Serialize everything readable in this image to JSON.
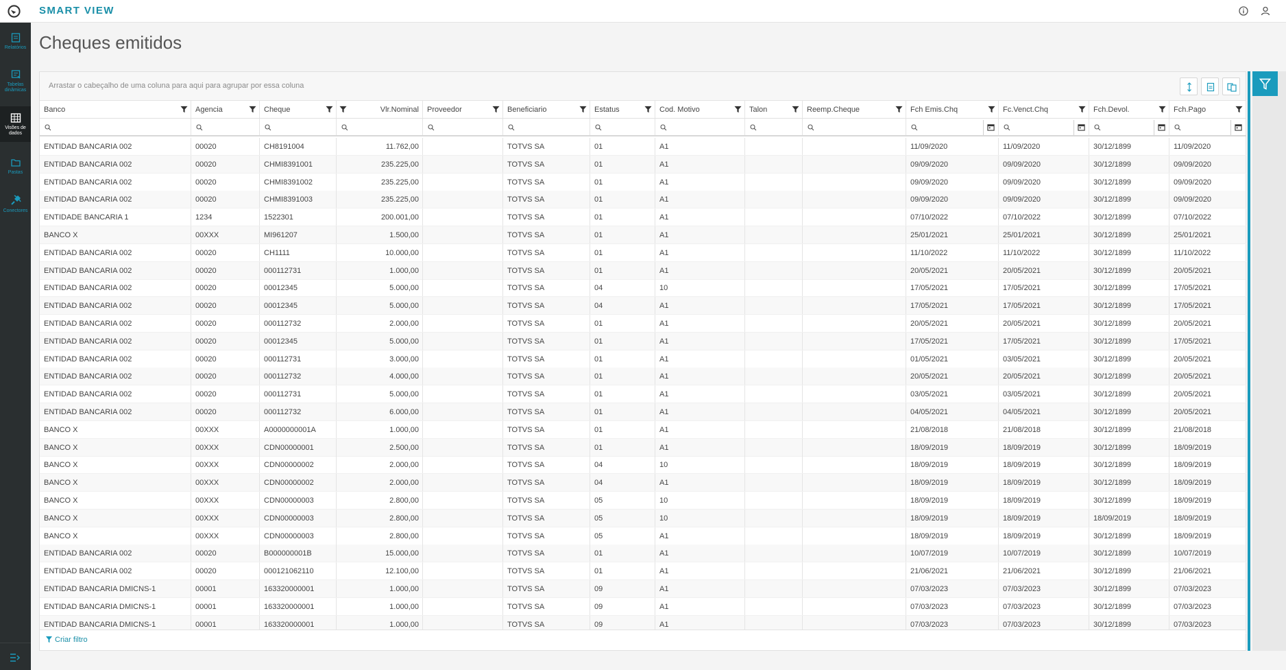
{
  "app": {
    "brand": "SMART VIEW"
  },
  "sidebar": {
    "items": [
      {
        "label": "Relatórios",
        "icon": "report-icon"
      },
      {
        "label": "Tabelas dinâmicas",
        "icon": "pivot-table-icon"
      },
      {
        "label": "Visões de dados",
        "icon": "data-grid-icon"
      },
      {
        "label": "Pastas",
        "icon": "folder-icon"
      },
      {
        "label": "Conectores",
        "icon": "plug-icon"
      }
    ]
  },
  "page": {
    "title": "Cheques emitidos"
  },
  "grid": {
    "group_hint": "Arrastar o cabeçalho de uma coluna para aqui para agrupar por essa coluna",
    "create_filter": "Criar filtro",
    "columns": [
      "Banco",
      "Agencia",
      "Cheque",
      "Vlr.Nominal",
      "Proveedor",
      "Beneficiario",
      "Estatus",
      "Cod. Motivo",
      "Talon",
      "Reemp.Cheque",
      "Fch Emis.Chq",
      "Fc.Venct.Chq",
      "Fch.Devol.",
      "Fch.Pago"
    ],
    "rows": [
      [
        "ENTIDAD BANCARIA 002",
        "00020",
        "CH8191004",
        "11.762,00",
        "",
        "TOTVS SA",
        "01",
        "A1",
        "",
        "",
        "11/09/2020",
        "11/09/2020",
        "30/12/1899",
        "11/09/2020"
      ],
      [
        "ENTIDAD BANCARIA 002",
        "00020",
        "CHMI8391001",
        "235.225,00",
        "",
        "TOTVS SA",
        "01",
        "A1",
        "",
        "",
        "09/09/2020",
        "09/09/2020",
        "30/12/1899",
        "09/09/2020"
      ],
      [
        "ENTIDAD BANCARIA 002",
        "00020",
        "CHMI8391002",
        "235.225,00",
        "",
        "TOTVS SA",
        "01",
        "A1",
        "",
        "",
        "09/09/2020",
        "09/09/2020",
        "30/12/1899",
        "09/09/2020"
      ],
      [
        "ENTIDAD BANCARIA 002",
        "00020",
        "CHMI8391003",
        "235.225,00",
        "",
        "TOTVS SA",
        "01",
        "A1",
        "",
        "",
        "09/09/2020",
        "09/09/2020",
        "30/12/1899",
        "09/09/2020"
      ],
      [
        "ENTIDADE BANCARIA 1",
        "1234",
        "1522301",
        "200.001,00",
        "",
        "TOTVS SA",
        "01",
        "A1",
        "",
        "",
        "07/10/2022",
        "07/10/2022",
        "30/12/1899",
        "07/10/2022"
      ],
      [
        "BANCO X",
        "00XXX",
        "MI961207",
        "1.500,00",
        "",
        "TOTVS SA",
        "01",
        "A1",
        "",
        "",
        "25/01/2021",
        "25/01/2021",
        "30/12/1899",
        "25/01/2021"
      ],
      [
        "ENTIDAD BANCARIA 002",
        "00020",
        "CH1111",
        "10.000,00",
        "",
        "TOTVS SA",
        "01",
        "A1",
        "",
        "",
        "11/10/2022",
        "11/10/2022",
        "30/12/1899",
        "11/10/2022"
      ],
      [
        "ENTIDAD BANCARIA 002",
        "00020",
        "000112731",
        "1.000,00",
        "",
        "TOTVS SA",
        "01",
        "A1",
        "",
        "",
        "20/05/2021",
        "20/05/2021",
        "30/12/1899",
        "20/05/2021"
      ],
      [
        "ENTIDAD BANCARIA 002",
        "00020",
        "00012345",
        "5.000,00",
        "",
        "TOTVS SA",
        "04",
        "10",
        "",
        "",
        "17/05/2021",
        "17/05/2021",
        "30/12/1899",
        "17/05/2021"
      ],
      [
        "ENTIDAD BANCARIA 002",
        "00020",
        "00012345",
        "5.000,00",
        "",
        "TOTVS SA",
        "04",
        "A1",
        "",
        "",
        "17/05/2021",
        "17/05/2021",
        "30/12/1899",
        "17/05/2021"
      ],
      [
        "ENTIDAD BANCARIA 002",
        "00020",
        "000112732",
        "2.000,00",
        "",
        "TOTVS SA",
        "01",
        "A1",
        "",
        "",
        "20/05/2021",
        "20/05/2021",
        "30/12/1899",
        "20/05/2021"
      ],
      [
        "ENTIDAD BANCARIA 002",
        "00020",
        "00012345",
        "5.000,00",
        "",
        "TOTVS SA",
        "01",
        "A1",
        "",
        "",
        "17/05/2021",
        "17/05/2021",
        "30/12/1899",
        "17/05/2021"
      ],
      [
        "ENTIDAD BANCARIA 002",
        "00020",
        "000112731",
        "3.000,00",
        "",
        "TOTVS SA",
        "01",
        "A1",
        "",
        "",
        "01/05/2021",
        "03/05/2021",
        "30/12/1899",
        "20/05/2021"
      ],
      [
        "ENTIDAD BANCARIA 002",
        "00020",
        "000112732",
        "4.000,00",
        "",
        "TOTVS SA",
        "01",
        "A1",
        "",
        "",
        "20/05/2021",
        "20/05/2021",
        "30/12/1899",
        "20/05/2021"
      ],
      [
        "ENTIDAD BANCARIA 002",
        "00020",
        "000112731",
        "5.000,00",
        "",
        "TOTVS SA",
        "01",
        "A1",
        "",
        "",
        "03/05/2021",
        "03/05/2021",
        "30/12/1899",
        "20/05/2021"
      ],
      [
        "ENTIDAD BANCARIA 002",
        "00020",
        "000112732",
        "6.000,00",
        "",
        "TOTVS SA",
        "01",
        "A1",
        "",
        "",
        "04/05/2021",
        "04/05/2021",
        "30/12/1899",
        "20/05/2021"
      ],
      [
        "BANCO X",
        "00XXX",
        "A0000000001A",
        "1.000,00",
        "",
        "TOTVS SA",
        "01",
        "A1",
        "",
        "",
        "21/08/2018",
        "21/08/2018",
        "30/12/1899",
        "21/08/2018"
      ],
      [
        "BANCO X",
        "00XXX",
        "CDN00000001",
        "2.500,00",
        "",
        "TOTVS SA",
        "01",
        "A1",
        "",
        "",
        "18/09/2019",
        "18/09/2019",
        "30/12/1899",
        "18/09/2019"
      ],
      [
        "BANCO X",
        "00XXX",
        "CDN00000002",
        "2.000,00",
        "",
        "TOTVS SA",
        "04",
        "10",
        "",
        "",
        "18/09/2019",
        "18/09/2019",
        "30/12/1899",
        "18/09/2019"
      ],
      [
        "BANCO X",
        "00XXX",
        "CDN00000002",
        "2.000,00",
        "",
        "TOTVS SA",
        "04",
        "A1",
        "",
        "",
        "18/09/2019",
        "18/09/2019",
        "30/12/1899",
        "18/09/2019"
      ],
      [
        "BANCO X",
        "00XXX",
        "CDN00000003",
        "2.800,00",
        "",
        "TOTVS SA",
        "05",
        "10",
        "",
        "",
        "18/09/2019",
        "18/09/2019",
        "30/12/1899",
        "18/09/2019"
      ],
      [
        "BANCO X",
        "00XXX",
        "CDN00000003",
        "2.800,00",
        "",
        "TOTVS SA",
        "05",
        "10",
        "",
        "",
        "18/09/2019",
        "18/09/2019",
        "18/09/2019",
        "18/09/2019"
      ],
      [
        "BANCO X",
        "00XXX",
        "CDN00000003",
        "2.800,00",
        "",
        "TOTVS SA",
        "05",
        "A1",
        "",
        "",
        "18/09/2019",
        "18/09/2019",
        "30/12/1899",
        "18/09/2019"
      ],
      [
        "ENTIDAD BANCARIA 002",
        "00020",
        "B000000001B",
        "15.000,00",
        "",
        "TOTVS SA",
        "01",
        "A1",
        "",
        "",
        "10/07/2019",
        "10/07/2019",
        "30/12/1899",
        "10/07/2019"
      ],
      [
        "ENTIDAD BANCARIA 002",
        "00020",
        "000121062110",
        "12.100,00",
        "",
        "TOTVS SA",
        "01",
        "A1",
        "",
        "",
        "21/06/2021",
        "21/06/2021",
        "30/12/1899",
        "21/06/2021"
      ],
      [
        "ENTIDAD BANCARIA DMICNS-1",
        "00001",
        "163320000001",
        "1.000,00",
        "",
        "TOTVS SA",
        "09",
        "A1",
        "",
        "",
        "07/03/2023",
        "07/03/2023",
        "30/12/1899",
        "07/03/2023"
      ],
      [
        "ENTIDAD BANCARIA DMICNS-1",
        "00001",
        "163320000001",
        "1.000,00",
        "",
        "TOTVS SA",
        "09",
        "A1",
        "",
        "",
        "07/03/2023",
        "07/03/2023",
        "30/12/1899",
        "07/03/2023"
      ],
      [
        "ENTIDAD BANCARIA DMICNS-1",
        "00001",
        "163320000001",
        "1.000,00",
        "",
        "TOTVS SA",
        "09",
        "A1",
        "",
        "",
        "07/03/2023",
        "07/03/2023",
        "30/12/1899",
        "07/03/2023"
      ]
    ]
  },
  "colors": {
    "accent": "#1a9bbd",
    "sidebar": "#2a2f30"
  }
}
